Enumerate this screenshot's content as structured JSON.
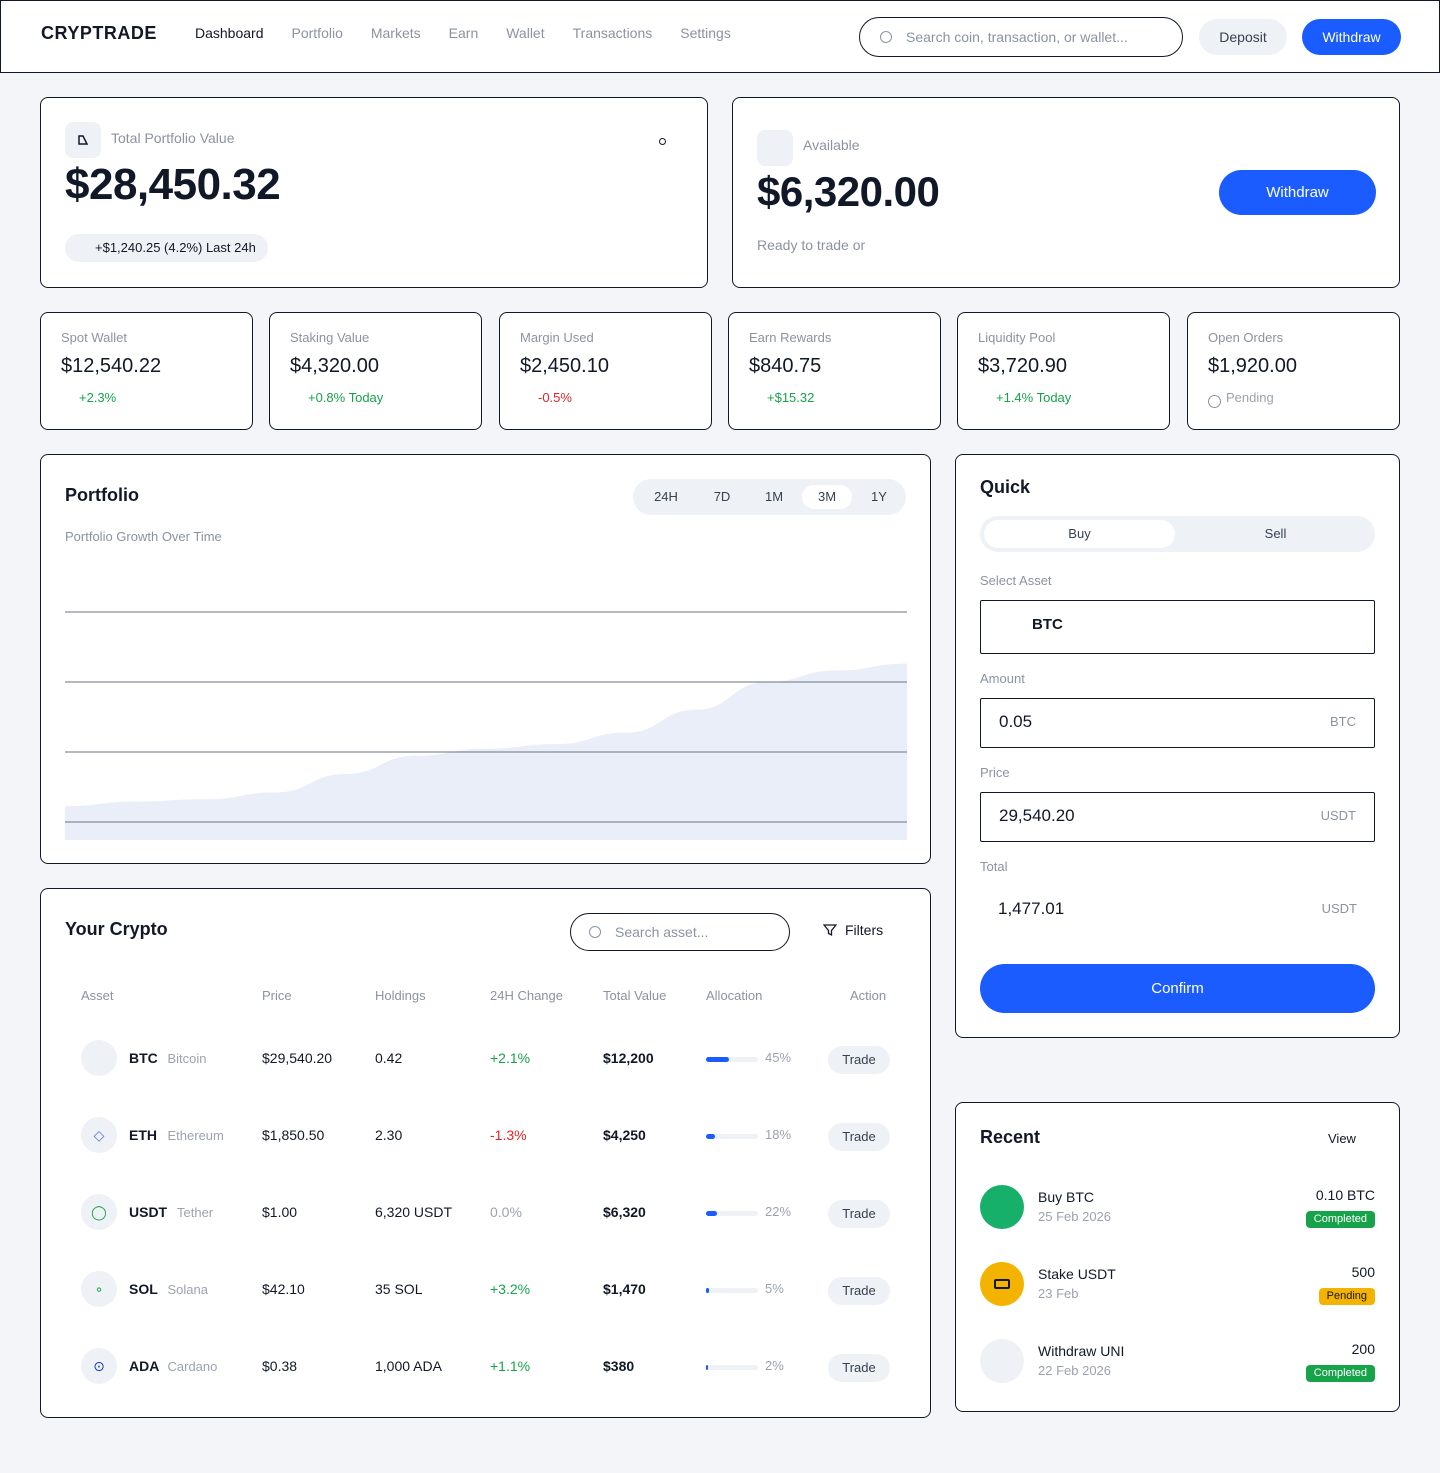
{
  "header": {
    "logo": "CRYPTRADE",
    "nav": [
      "Dashboard",
      "Portfolio",
      "Markets",
      "Earn",
      "Wallet",
      "Transactions",
      "Settings"
    ],
    "search_placeholder": "Search coin, transaction, or wallet...",
    "deposit_label": "Deposit",
    "withdraw_label": "Withdraw"
  },
  "portfolio_value": {
    "label": "Total Portfolio Value",
    "value": "$28,450.32",
    "change": "+$1,240.25 (4.2%) Last 24h"
  },
  "available": {
    "label": "Available",
    "value": "$6,320.00",
    "sub": "Ready to trade or",
    "withdraw_label": "Withdraw"
  },
  "stats": [
    {
      "label": "Spot Wallet",
      "value": "$12,540.22",
      "change": "+2.3%",
      "tone": "pos"
    },
    {
      "label": "Staking Value",
      "value": "$4,320.00",
      "change": "+0.8% Today",
      "tone": "pos"
    },
    {
      "label": "Margin Used",
      "value": "$2,450.10",
      "change": "-0.5%",
      "tone": "neg"
    },
    {
      "label": "Earn Rewards",
      "value": "$840.75",
      "change": "+$15.32",
      "tone": "pos"
    },
    {
      "label": "Liquidity Pool",
      "value": "$3,720.90",
      "change": "+1.4% Today",
      "tone": "pos"
    },
    {
      "label": "Open Orders",
      "value": "$1,920.00",
      "change": "Pending",
      "tone": "zero"
    }
  ],
  "portfolio_chart": {
    "title": "Portfolio",
    "subtitle": "Portfolio Growth Over Time",
    "ranges": [
      "24H",
      "7D",
      "1M",
      "3M",
      "1Y"
    ],
    "active_range": "3M"
  },
  "chart_data": {
    "type": "area",
    "title": "Portfolio Growth Over Time",
    "x": [
      0,
      1,
      2,
      3,
      4,
      5,
      6,
      7,
      8,
      9,
      10,
      11,
      12
    ],
    "values": [
      6,
      8,
      9,
      12,
      20,
      28,
      31,
      33,
      38,
      48,
      60,
      65,
      68
    ],
    "ylim": [
      0,
      100
    ],
    "grid": true,
    "color": "#e9eef8"
  },
  "quick": {
    "title": "Quick",
    "buy_label": "Buy",
    "sell_label": "Sell",
    "asset_label": "Select Asset",
    "asset_value": "BTC",
    "amount_label": "Amount",
    "amount_value": "0.05",
    "amount_unit": "BTC",
    "price_label": "Price",
    "price_value": "29,540.20",
    "price_unit": "USDT",
    "total_label": "Total",
    "total_value": "1,477.01",
    "total_unit": "USDT",
    "confirm_label": "Confirm"
  },
  "crypto_table": {
    "title": "Your Crypto",
    "search_placeholder": "Search asset...",
    "filters_label": "Filters",
    "headers": [
      "Asset",
      "Price",
      "Holdings",
      "24H Change",
      "Total Value",
      "Allocation",
      "Action"
    ],
    "rows": [
      {
        "symbol": "BTC",
        "name": "Bitcoin",
        "price": "$29,540.20",
        "holdings": "0.42",
        "change": "+2.1%",
        "tone": "pos",
        "total": "$12,200",
        "allocation": "45%",
        "alloc_pct": 45,
        "action": "Trade",
        "icon": ""
      },
      {
        "symbol": "ETH",
        "name": "Ethereum",
        "price": "$1,850.50",
        "holdings": "2.30",
        "change": "-1.3%",
        "tone": "neg",
        "total": "$4,250",
        "allocation": "18%",
        "alloc_pct": 18,
        "action": "Trade",
        "icon": "◇"
      },
      {
        "symbol": "USDT",
        "name": "Tether",
        "price": "$1.00",
        "holdings": "6,320 USDT",
        "change": "0.0%",
        "tone": "zero",
        "total": "$6,320",
        "allocation": "22%",
        "alloc_pct": 22,
        "action": "Trade",
        "icon": "◯"
      },
      {
        "symbol": "SOL",
        "name": "Solana",
        "price": "$42.10",
        "holdings": "35 SOL",
        "change": "+3.2%",
        "tone": "pos",
        "total": "$1,470",
        "allocation": "5%",
        "alloc_pct": 5,
        "action": "Trade",
        "icon": "∘"
      },
      {
        "symbol": "ADA",
        "name": "Cardano",
        "price": "$0.38",
        "holdings": "1,000 ADA",
        "change": "+1.1%",
        "tone": "pos",
        "total": "$380",
        "allocation": "2%",
        "alloc_pct": 2,
        "action": "Trade",
        "icon": "⊙"
      }
    ]
  },
  "recent": {
    "title": "Recent",
    "view_label": "View",
    "items": [
      {
        "title": "Buy BTC",
        "date": "25 Feb 2026",
        "amount": "0.10 BTC",
        "status": "Completed",
        "status_color": "#16a34a",
        "avatar_color": "#16b06b"
      },
      {
        "title": "Stake USDT",
        "date": "23 Feb",
        "amount": "500",
        "status": "Pending",
        "status_color": "#f5b301",
        "avatar_color": "#f5b301"
      },
      {
        "title": "Withdraw UNI",
        "date": "22 Feb 2026",
        "amount": "200",
        "status": "Completed",
        "status_color": "#16a34a",
        "avatar_color": "#eef1f5"
      }
    ]
  },
  "colors": {
    "accent": "#1a5cff",
    "positive": "#16a34a",
    "negative": "#dc2626"
  }
}
